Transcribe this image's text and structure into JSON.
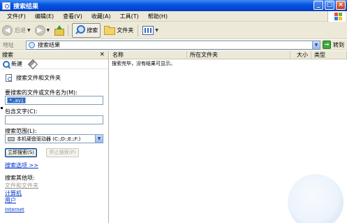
{
  "window": {
    "title": "搜索结果"
  },
  "menu": [
    "文件(F)",
    "编辑(E)",
    "查看(V)",
    "收藏(A)",
    "工具(T)",
    "帮助(H)"
  ],
  "window_buttons": {
    "minimize": "_",
    "maximize": "□",
    "close": "×"
  },
  "toolbar": {
    "back": "后退",
    "search": "搜索",
    "folders": "文件夹",
    "back_arrow": "◀",
    "forward_arrow": "▶",
    "dropdown_caret": "▼"
  },
  "address": {
    "label": "地址",
    "value": "搜索结果",
    "go": "转到",
    "go_arrow": "→",
    "dropdown": "▼"
  },
  "search_pane": {
    "header": "搜索",
    "close": "×",
    "new": "新建",
    "search_files": "搜索文件和文件夹",
    "name_label": "要搜索的文件或文件名为(M):",
    "name_value": "*.avi",
    "text_label": "包含文字(C):",
    "text_value": "",
    "scope_label": "搜索范围(L):",
    "scope_value": "本机硬盘驱动器 (C:;D:;E:;F:)",
    "scope_dropdown": "▼",
    "search_now": "立即搜索(S)",
    "stop": "停止搜索(P)",
    "options": "搜索选项 >>",
    "other_label": "搜索其他项:",
    "other_items": [
      "文件和文件夹",
      "计算机",
      "用户",
      "Internet"
    ]
  },
  "list": {
    "columns": [
      "名称",
      "所在文件夹",
      "大小",
      "类型"
    ],
    "empty_message": "搜索完毕，没有结果可显示。"
  }
}
